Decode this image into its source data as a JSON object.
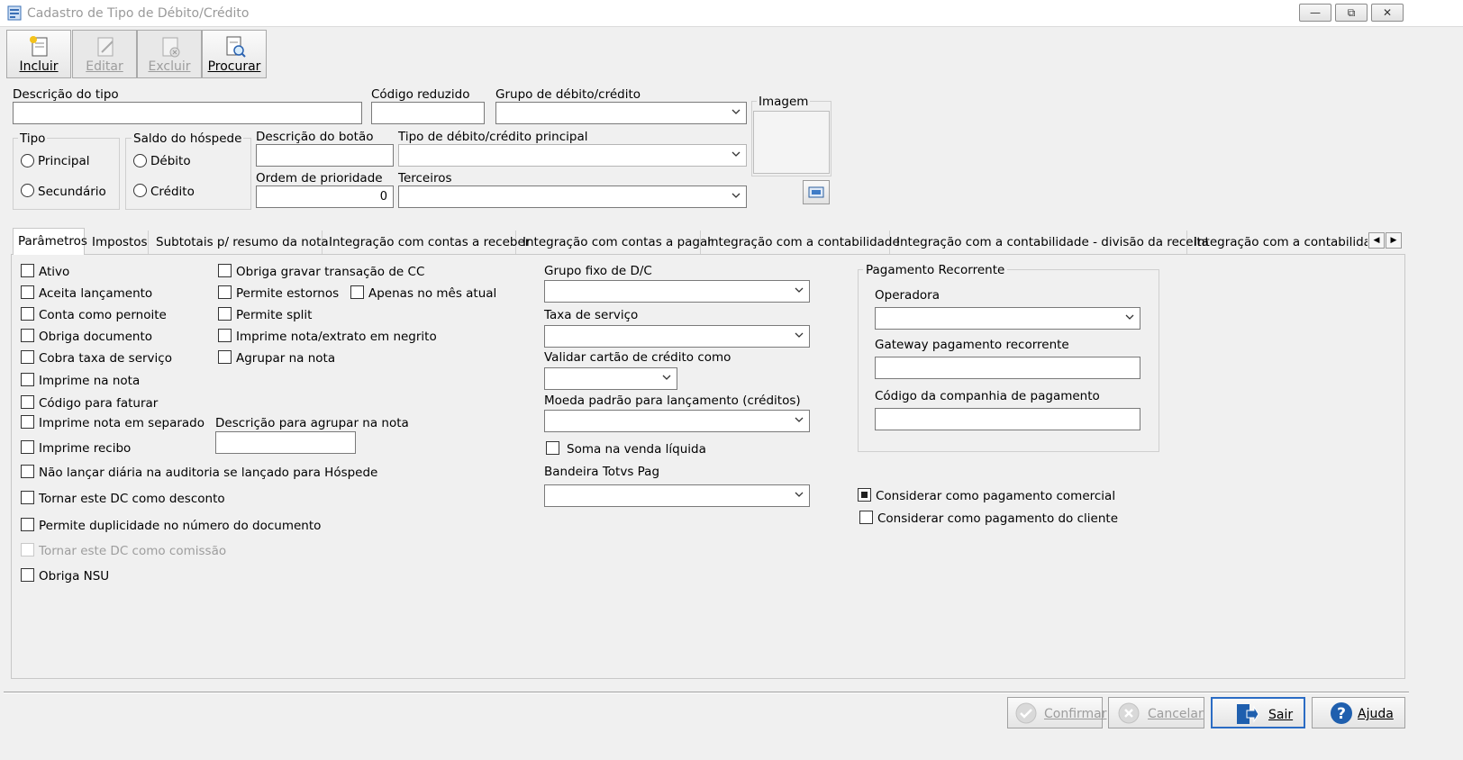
{
  "window": {
    "title": "Cadastro de Tipo de Débito/Crédito",
    "controls": {
      "minimize": "▭",
      "restore": "⧉",
      "close": "✕"
    }
  },
  "toolbar": {
    "incluir": "Incluir",
    "editar": "Editar",
    "excluir": "Excluir",
    "procurar": "Procurar"
  },
  "header": {
    "descricao_tipo_label": "Descrição do tipo",
    "codigo_reduzido_label": "Código reduzido",
    "grupo_label": "Grupo de débito/crédito",
    "imagem_label": "Imagem",
    "tipo_label": "Tipo",
    "tipo_principal": "Principal",
    "tipo_secundario": "Secundário",
    "saldo_label": "Saldo do hóspede",
    "saldo_debito": "Débito",
    "saldo_credito": "Crédito",
    "descricao_botao_label": "Descrição do botão",
    "tipo_principal_label": "Tipo de débito/crédito principal",
    "ordem_label": "Ordem de prioridade",
    "ordem_value": "0",
    "terceiros_label": "Terceiros"
  },
  "tabs": [
    "Parâmetros",
    "Impostos",
    "Subtotais p/ resumo da nota",
    "Integração com contas a receber",
    "Integração com contas a pagar",
    "Integração com a contabilidade",
    "Integração com a contabilidade - divisão da receita",
    "Integração com a contabilidade"
  ],
  "params": {
    "col1": [
      "Ativo",
      "Aceita lançamento",
      "Conta como pernoite",
      "Obriga documento",
      "Cobra taxa de serviço",
      "Imprime na nota",
      "Código para faturar",
      "Imprime nota em separado",
      "Imprime recibo",
      "Não lançar diária na auditoria se lançado para Hóspede",
      "Tornar este DC como desconto",
      "Permite duplicidade no número do documento",
      "Tornar este DC como comissão",
      "Obriga NSU"
    ],
    "col2": [
      "Obriga gravar transação de CC",
      "Permite estornos",
      "Permite split",
      "Imprime nota/extrato em negrito",
      "Agrupar na nota"
    ],
    "apenas_mes_atual": "Apenas no mês atual",
    "descricao_agrupar_label": "Descrição para agrupar na nota",
    "grupo_fixo_label": "Grupo fixo de D/C",
    "taxa_servico_label": "Taxa de serviço",
    "validar_cartao_label": "Validar cartão de crédito como",
    "moeda_label": "Moeda padrão para lançamento (créditos)",
    "soma_venda": "Soma na venda líquida",
    "bandeira_label": "Bandeira Totvs Pag",
    "pagamento_recorrente_title": "Pagamento Recorrente",
    "operadora_label": "Operadora",
    "gateway_label": "Gateway pagamento recorrente",
    "codigo_companhia_label": "Código da companhia de pagamento",
    "considerar_comercial": "Considerar como pagamento comercial",
    "considerar_cliente": "Considerar como pagamento do cliente"
  },
  "footer": {
    "confirmar": "Confirmar",
    "cancelar": "Cancelar",
    "sair": "Sair",
    "ajuda": "Ajuda"
  }
}
